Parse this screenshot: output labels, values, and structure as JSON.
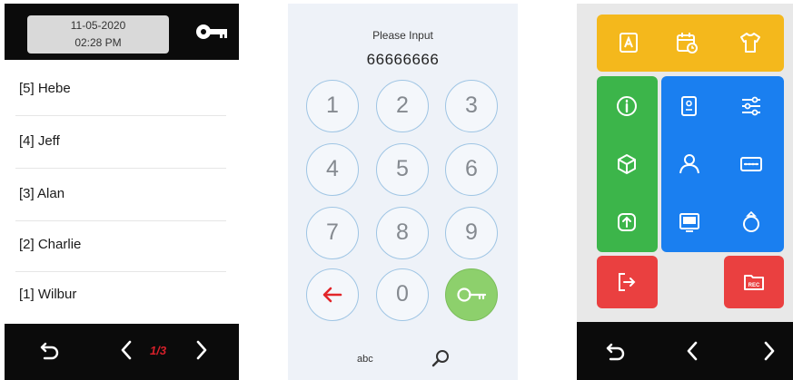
{
  "user_list_screen": {
    "date": "11-05-2020",
    "time": "02:28 PM",
    "users": [
      "[5] Hebe",
      "[4] Jeff",
      "[3] Alan",
      "[2] Charlie",
      "[1] Wilbur"
    ],
    "page_indicator": "1/3"
  },
  "keypad_screen": {
    "prompt": "Please Input",
    "input_value": "66666666",
    "keys": [
      "1",
      "2",
      "3",
      "4",
      "5",
      "6",
      "7",
      "8",
      "9",
      "",
      "0",
      ""
    ],
    "abc_label": "abc"
  },
  "menu_screen": {
    "colors": {
      "yellow": "#f4b81c",
      "green": "#3cb54a",
      "blue": "#1a7ff0",
      "red": "#ea4040",
      "background": "#e8e8e8"
    },
    "tiles": [
      {
        "icon": "user-card-icon"
      },
      {
        "icon": "calendar-clock-icon"
      },
      {
        "icon": "shirt-icon"
      },
      {
        "icon": "info-icon"
      },
      {
        "icon": "cube-icon"
      },
      {
        "icon": "upload-device-icon"
      },
      {
        "icon": "face-device-icon"
      },
      {
        "icon": "settings-sliders-icon"
      },
      {
        "icon": "user-icon"
      },
      {
        "icon": "password-field-icon"
      },
      {
        "icon": "monitor-icon"
      },
      {
        "icon": "ring-icon"
      },
      {
        "icon": "exit-icon"
      },
      {
        "icon": "rec-icon",
        "label": "REC"
      }
    ]
  }
}
